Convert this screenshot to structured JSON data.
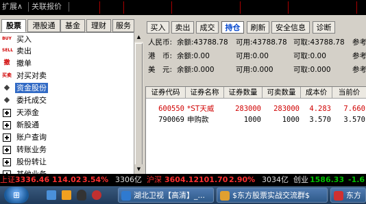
{
  "topbar": {
    "expand": "扩展∧",
    "guanlian": "关联报价"
  },
  "left_tabs": [
    {
      "label": "股票",
      "active": true
    },
    {
      "label": "港股通",
      "active": false
    },
    {
      "label": "基金",
      "active": false
    },
    {
      "label": "理财",
      "active": false
    },
    {
      "label": "服务",
      "active": false
    }
  ],
  "left_menu": [
    {
      "label": "买入",
      "icon": "buy-icon",
      "icon_text": "BUY",
      "color": "#d00000"
    },
    {
      "label": "卖出",
      "icon": "sell-icon",
      "icon_text": "SELL",
      "color": "#d00000"
    },
    {
      "label": "撤单",
      "icon": "cancel-order-icon",
      "icon_text": "撤",
      "color": "#d00000"
    },
    {
      "label": "对买对卖",
      "icon": "buy-sell-icon",
      "icon_text": "买卖",
      "color": "#d00000"
    },
    {
      "label": "资金股份",
      "icon": "funds-shares-icon",
      "icon_text": "◆",
      "color": "#404040",
      "selected": true
    },
    {
      "label": "委托成交",
      "icon": "orders-icon",
      "icon_text": "◆",
      "color": "#404040"
    },
    {
      "label": "天添金",
      "icon": "expand-icon"
    },
    {
      "label": "新股通",
      "icon": "expand-icon"
    },
    {
      "label": "账户查询",
      "icon": "expand-icon"
    },
    {
      "label": "转账业务",
      "icon": "expand-icon"
    },
    {
      "label": "股份转让",
      "icon": "expand-icon"
    },
    {
      "label": "其他业务",
      "icon": "expand-icon"
    }
  ],
  "right_buttons": [
    {
      "label": "买入",
      "active": false
    },
    {
      "label": "卖出",
      "active": false
    },
    {
      "label": "成交",
      "active": false
    },
    {
      "label": "持仓",
      "active": true
    },
    {
      "label": "刷新",
      "active": false
    },
    {
      "label": "安全信息",
      "active": false
    },
    {
      "label": "诊断",
      "active": false
    }
  ],
  "balances": [
    {
      "currency": "人民币:",
      "balance": "余额:43788.78",
      "available": "可用:43788.78",
      "withdrawable": "可取:43788.78",
      "ref": "参考"
    },
    {
      "currency": "港　币:",
      "balance": "余额:0.00",
      "available": "可用:0.00",
      "withdrawable": "可取:0.00",
      "ref": "参考"
    },
    {
      "currency": "美　元:",
      "balance": "余额:0.000",
      "available": "可用:0.000",
      "withdrawable": "可取:0.000",
      "ref": "参考"
    }
  ],
  "table": {
    "headers": [
      "证券代码",
      "证券名称",
      "证券数量",
      "可卖数量",
      "成本价",
      "当前价"
    ],
    "rows": [
      {
        "code": "600550",
        "name": "*ST天威",
        "qty": "283000",
        "sellable": "283000",
        "cost": "4.283",
        "price": "7.660",
        "color": "#d00000"
      },
      {
        "code": "790069",
        "name": "申购款",
        "qty": "1000",
        "sellable": "1000",
        "cost": "3.570",
        "price": "3.570",
        "color": "#000000"
      }
    ]
  },
  "status": {
    "sh_label": "上证",
    "sh_value": "3336.46",
    "sh_change": "114.02",
    "sh_pct": "3.54%",
    "sh_vol": "3306亿",
    "hs_label": "沪深",
    "hs_value": "3604.12",
    "hs_change": "101.70",
    "hs_pct": "2.90%",
    "hs_vol": "3034亿",
    "cy_label": "创业",
    "cy_value": "1586.33",
    "cy_change": "-1.6"
  },
  "taskbar": {
    "tasks": [
      "湖北卫视【高清】_...",
      "$东方股票实战交流群$",
      "东方"
    ]
  },
  "colors": {
    "up": "#ff3030",
    "down": "#00c000",
    "selected": "#316ac5",
    "active_btn_text": "#0044cc"
  }
}
